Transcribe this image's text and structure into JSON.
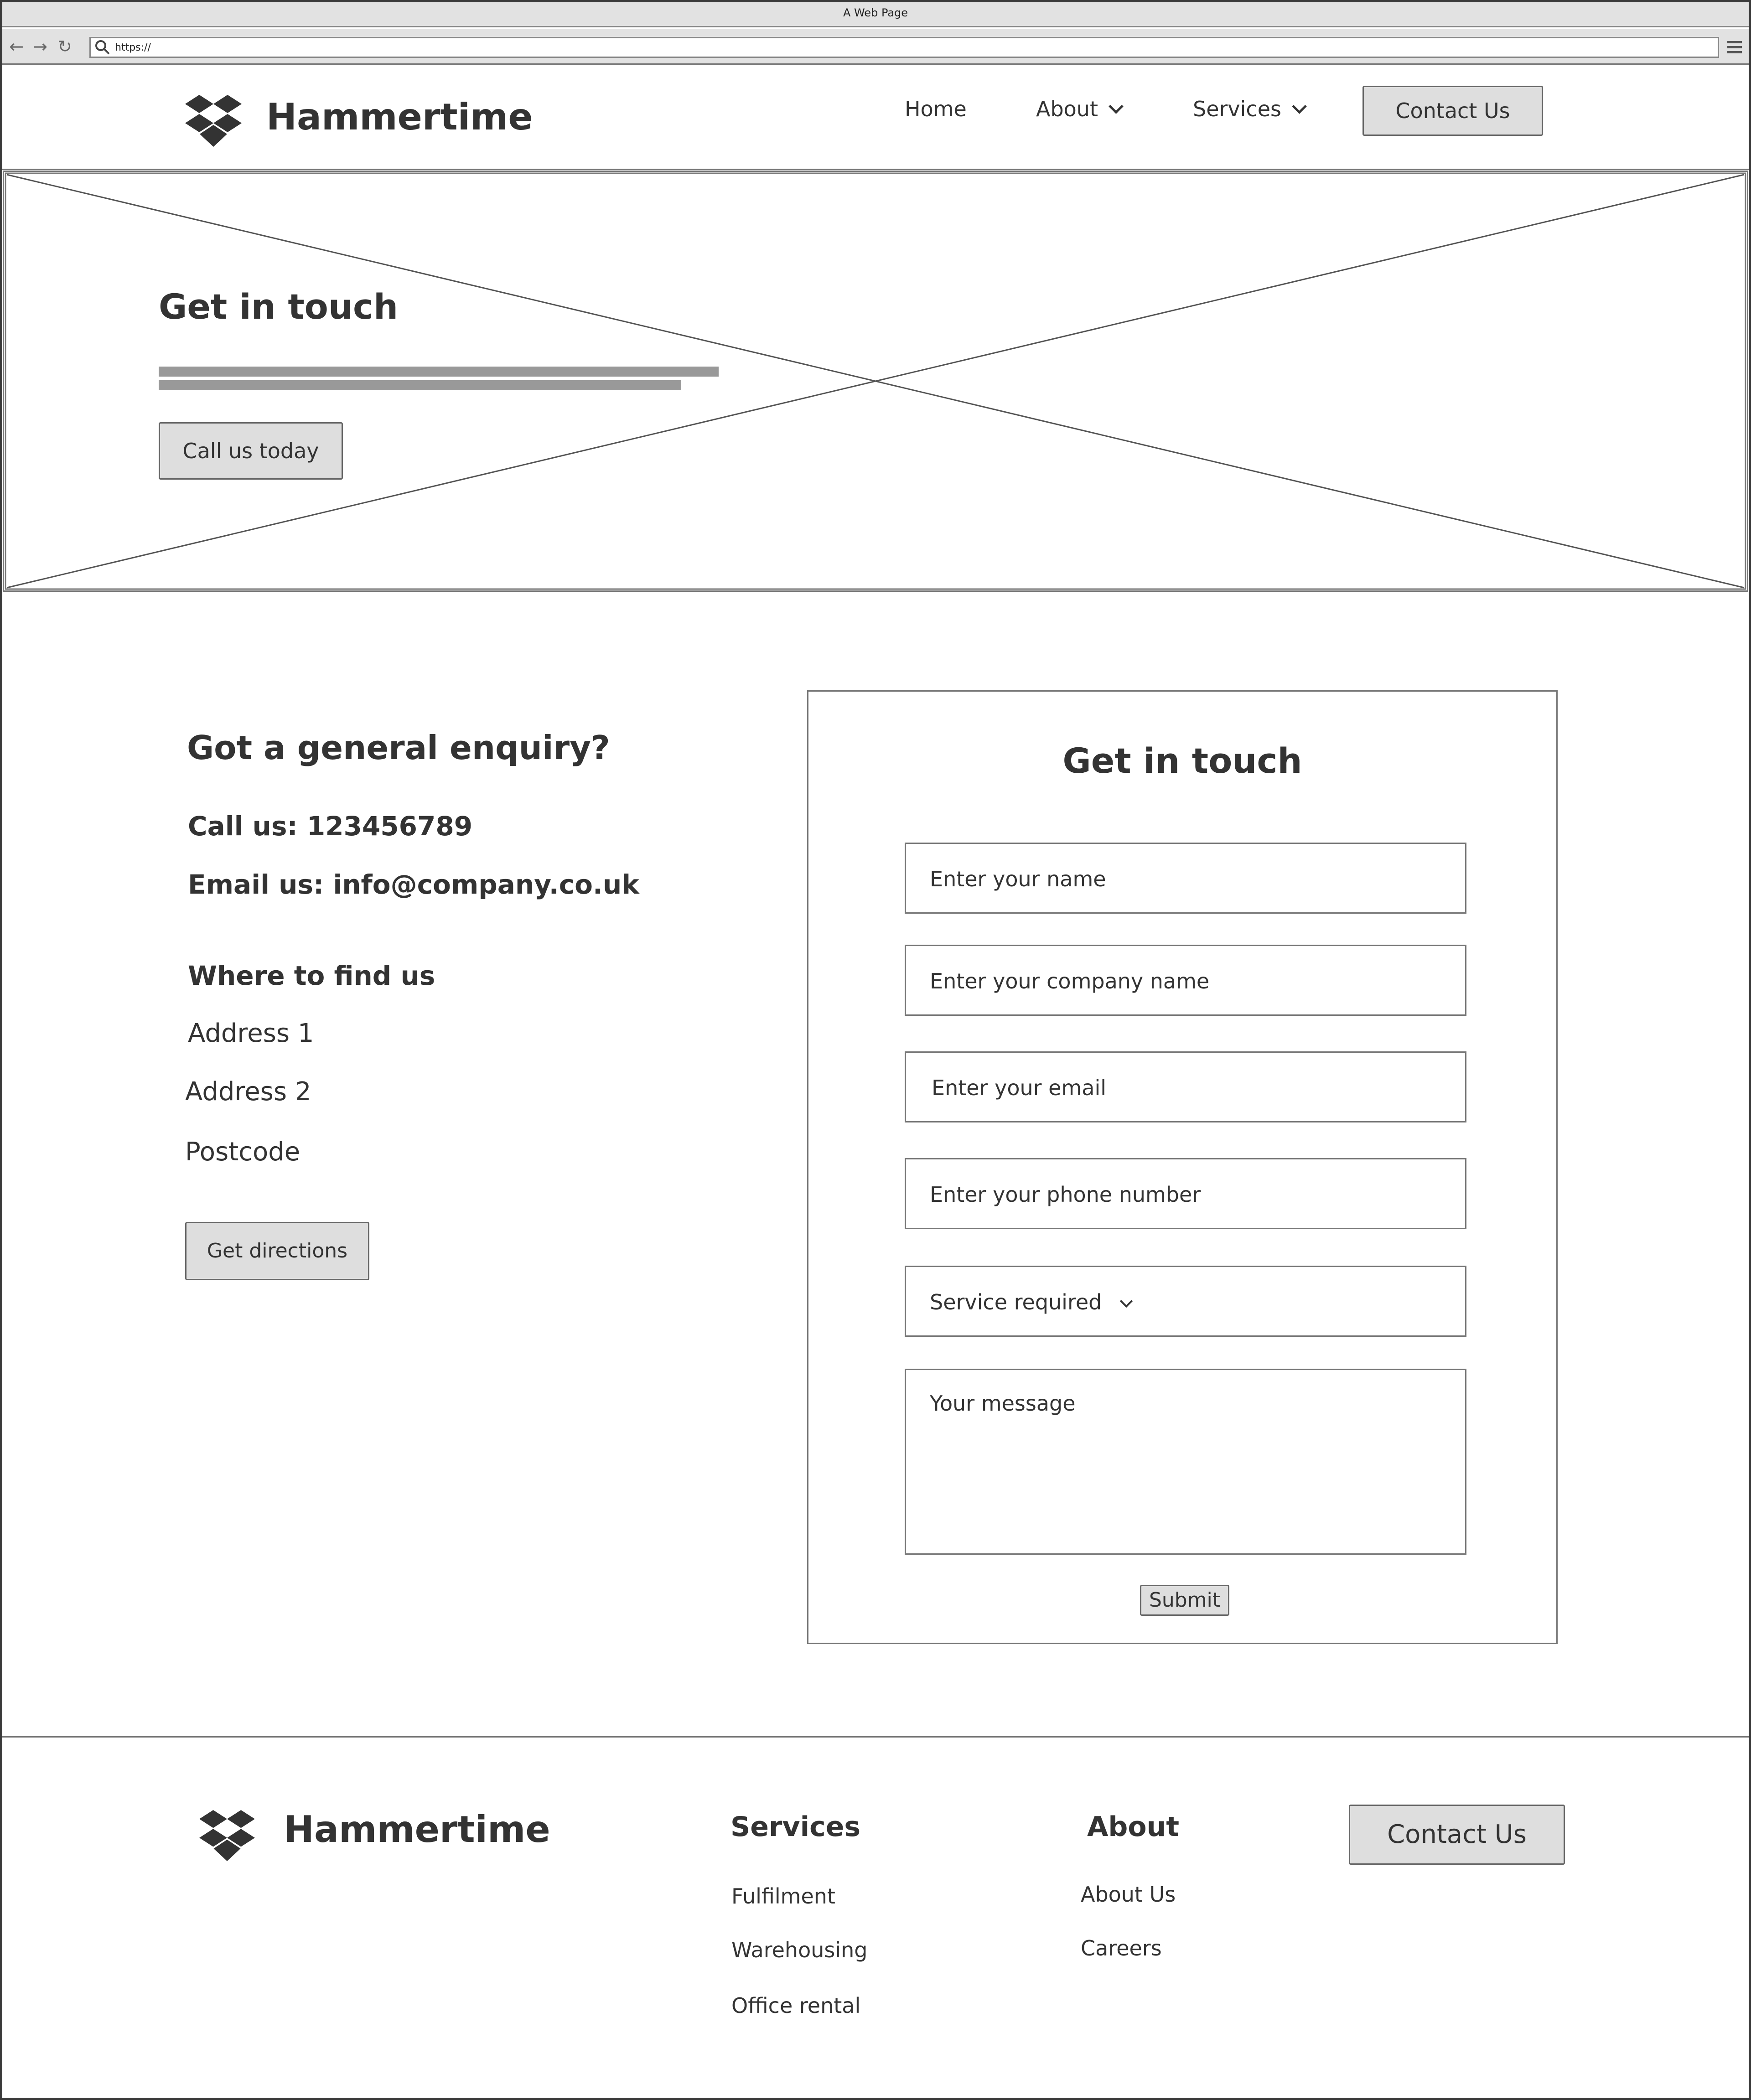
{
  "browser": {
    "title": "A Web Page",
    "url": "https://"
  },
  "header": {
    "brand": "Hammertime",
    "nav": {
      "home": "Home",
      "about": "About",
      "services": "Services",
      "contact": "Contact Us"
    }
  },
  "hero": {
    "title": "Get in touch",
    "button": "Call us today"
  },
  "contact": {
    "heading": "Got a general enquiry?",
    "phone": "Call us: 123456789",
    "email": "Email us: info@company.co.uk",
    "find_heading": "Where to find us",
    "address1": "Address 1",
    "address2": "Address 2",
    "postcode": "Postcode",
    "directions_button": "Get directions"
  },
  "form": {
    "title": "Get in touch",
    "name_placeholder": "Enter your name",
    "company_placeholder": "Enter your company name",
    "email_placeholder": "Enter your email",
    "phone_placeholder": "Enter your phone number",
    "service_select": "Service required",
    "message_placeholder": "Your message",
    "submit": "Submit"
  },
  "footer": {
    "brand": "Hammertime",
    "services_heading": "Services",
    "services_links": [
      "Fulfilment",
      "Warehousing",
      "Office rental"
    ],
    "about_heading": "About",
    "about_links": [
      "About Us",
      "Careers"
    ],
    "contact_button": "Contact Us"
  }
}
